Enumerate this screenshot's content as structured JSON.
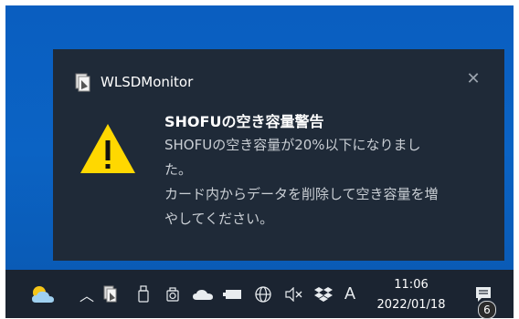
{
  "toast": {
    "app_name": "WLSDMonitor",
    "close_glyph": "✕",
    "title": "SHOFUの空き容量警告",
    "body_lines": [
      "SHOFUの空き容量が20%以下になりまし",
      "た。",
      "カード内からデータを削除して空き容量を増",
      "やしてください。"
    ],
    "icon": "warning-triangle-icon"
  },
  "taskbar": {
    "chevron_glyph": "︿",
    "ime_label": "A",
    "time": "11:06",
    "date": "2022/01/18",
    "notification_count": "6",
    "icons": [
      "weather-icon",
      "show-hidden-icons-chevron",
      "wlsdmonitor-tray-icon",
      "usb-drive-icon",
      "camera-icon",
      "onedrive-cloud-icon",
      "battery-icon",
      "network-globe-icon",
      "volume-muted-icon",
      "dropbox-icon",
      "ime-mode-icon",
      "action-center-icon"
    ]
  },
  "colors": {
    "desktop": "#0a5ec0",
    "toast_bg": "#1f2a38",
    "taskbar_bg": "#1b2431",
    "warning_yellow": "#ffd800"
  }
}
